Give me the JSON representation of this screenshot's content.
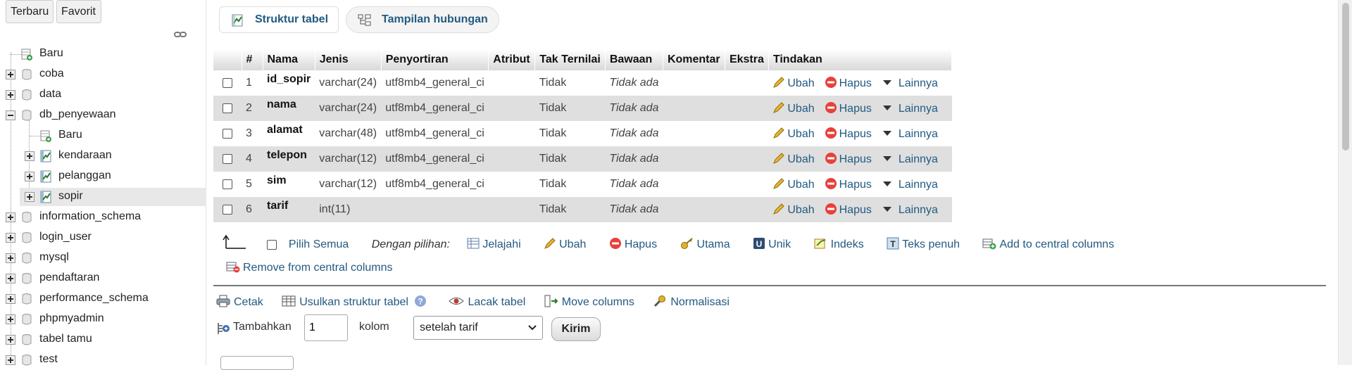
{
  "nav": {
    "tabs": [
      "Terbaru",
      "Favorit"
    ],
    "tree": [
      {
        "label": "Baru",
        "level": 0,
        "kind": "new"
      },
      {
        "label": "coba",
        "level": 0,
        "kind": "db"
      },
      {
        "label": "data",
        "level": 0,
        "kind": "db"
      },
      {
        "label": "db_penyewaan",
        "level": 0,
        "kind": "db-open"
      },
      {
        "label": "Baru",
        "level": 1,
        "kind": "new"
      },
      {
        "label": "kendaraan",
        "level": 1,
        "kind": "table"
      },
      {
        "label": "pelanggan",
        "level": 1,
        "kind": "table"
      },
      {
        "label": "sopir",
        "level": 1,
        "kind": "table",
        "selected": true
      },
      {
        "label": "information_schema",
        "level": 0,
        "kind": "db"
      },
      {
        "label": "login_user",
        "level": 0,
        "kind": "db"
      },
      {
        "label": "mysql",
        "level": 0,
        "kind": "db"
      },
      {
        "label": "pendaftaran",
        "level": 0,
        "kind": "db"
      },
      {
        "label": "performance_schema",
        "level": 0,
        "kind": "db"
      },
      {
        "label": "phpmyadmin",
        "level": 0,
        "kind": "db"
      },
      {
        "label": "tabel tamu",
        "level": 0,
        "kind": "db"
      },
      {
        "label": "test",
        "level": 0,
        "kind": "db"
      }
    ]
  },
  "tabs": {
    "struktur": "Struktur tabel",
    "hubungan": "Tampilan hubungan"
  },
  "table": {
    "headers": [
      "#",
      "Nama",
      "Jenis",
      "Penyortiran",
      "Atribut",
      "Tak Ternilai",
      "Bawaan",
      "Komentar",
      "Ekstra",
      "Tindakan"
    ],
    "rows": [
      {
        "num": "1",
        "name": "id_sopir",
        "type": "varchar(24)",
        "collation": "utf8mb4_general_ci",
        "null": "Tidak",
        "default": "Tidak ada"
      },
      {
        "num": "2",
        "name": "nama",
        "type": "varchar(24)",
        "collation": "utf8mb4_general_ci",
        "null": "Tidak",
        "default": "Tidak ada"
      },
      {
        "num": "3",
        "name": "alamat",
        "type": "varchar(48)",
        "collation": "utf8mb4_general_ci",
        "null": "Tidak",
        "default": "Tidak ada"
      },
      {
        "num": "4",
        "name": "telepon",
        "type": "varchar(12)",
        "collation": "utf8mb4_general_ci",
        "null": "Tidak",
        "default": "Tidak ada"
      },
      {
        "num": "5",
        "name": "sim",
        "type": "varchar(12)",
        "collation": "utf8mb4_general_ci",
        "null": "Tidak",
        "default": "Tidak ada"
      },
      {
        "num": "6",
        "name": "tarif",
        "type": "int(11)",
        "collation": "",
        "null": "Tidak",
        "default": "Tidak ada"
      }
    ],
    "actions": {
      "edit": "Ubah",
      "drop": "Hapus",
      "more": "Lainnya"
    }
  },
  "bulk": {
    "check_all": "Pilih Semua",
    "with_selected": "Dengan pilihan:",
    "browse": "Jelajahi",
    "edit": "Ubah",
    "drop": "Hapus",
    "primary": "Utama",
    "unique": "Unik",
    "index": "Indeks",
    "fulltext": "Teks penuh",
    "add_central": "Add to central columns",
    "remove_central": "Remove from central columns"
  },
  "ops": {
    "print": "Cetak",
    "propose": "Usulkan struktur tabel",
    "track": "Lacak tabel",
    "move": "Move columns",
    "normalize": "Normalisasi"
  },
  "add": {
    "label": "Tambahkan",
    "count": "1",
    "unit": "kolom",
    "position": "setelah tarif",
    "submit": "Kirim"
  }
}
